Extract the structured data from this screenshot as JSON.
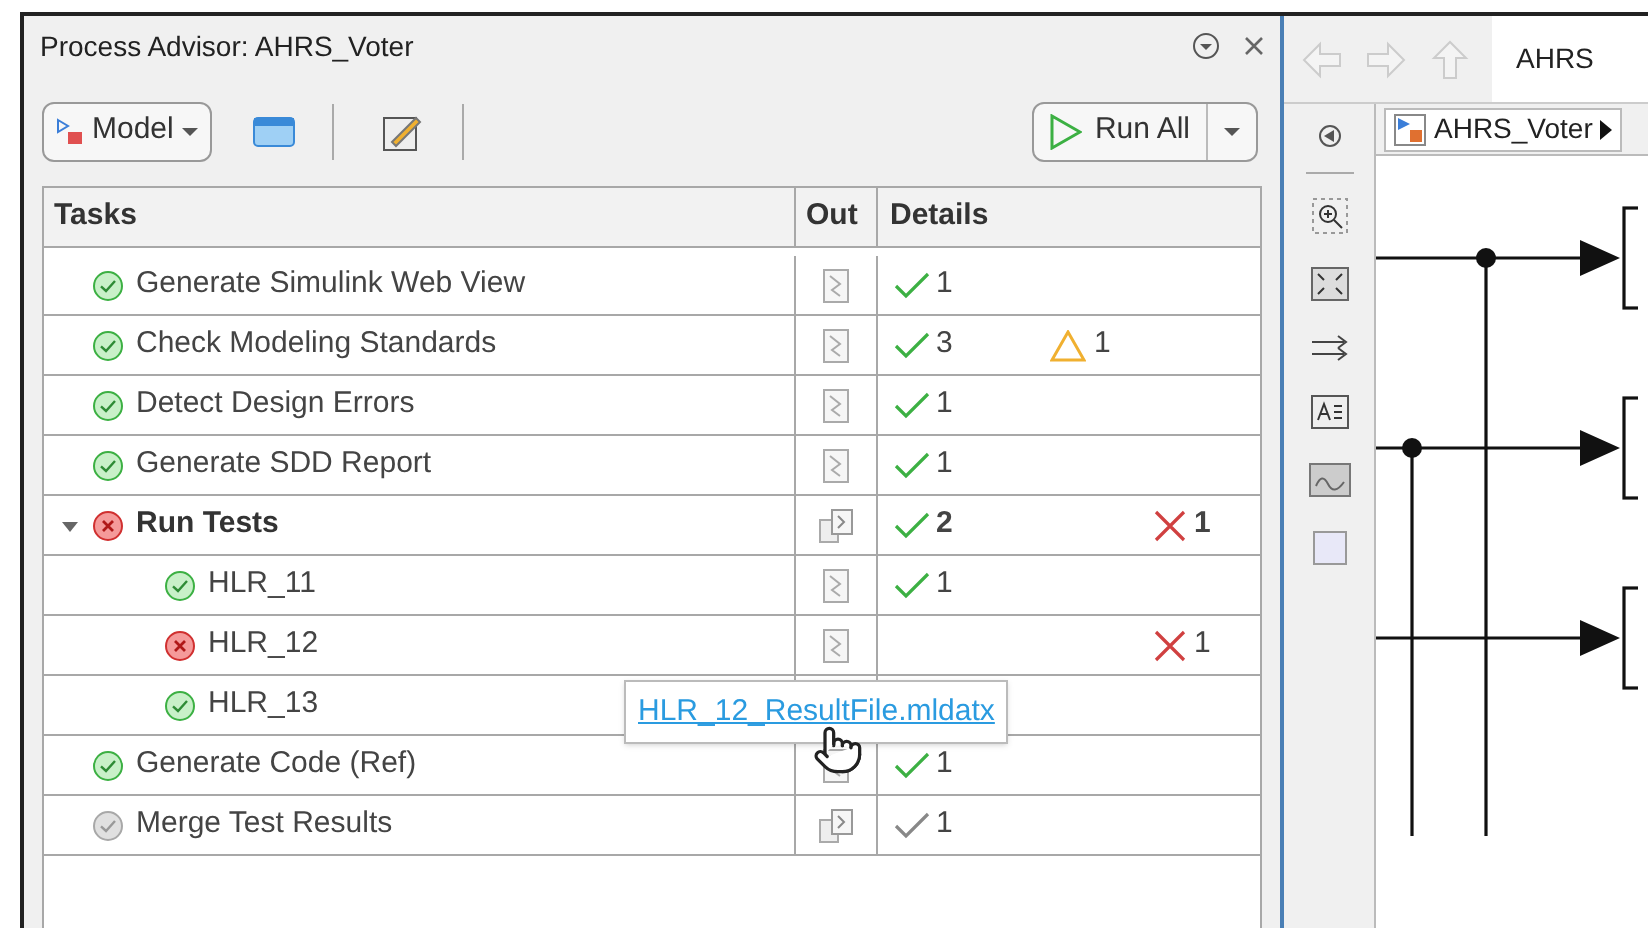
{
  "panel": {
    "title": "Process Advisor: AHRS_Voter",
    "model_button": "Model",
    "run_button": "Run All"
  },
  "table": {
    "columns": [
      "Tasks",
      "Out",
      "Details"
    ],
    "rows": [
      {
        "name": "Generate Simulink Web View",
        "failed": false,
        "stale": false,
        "multiple_outputs": false,
        "details": {
          "pass": "1"
        }
      },
      {
        "name": "Check Modeling Standards",
        "failed": false,
        "stale": false,
        "multiple_outputs": false,
        "details": {
          "pass": "3",
          "warn": "1"
        }
      },
      {
        "name": "Detect Design Errors",
        "failed": false,
        "stale": false,
        "multiple_outputs": false,
        "details": {
          "pass": "1"
        }
      },
      {
        "name": "Generate SDD Report",
        "failed": false,
        "stale": false,
        "multiple_outputs": false,
        "details": {
          "pass": "1"
        }
      },
      {
        "name": "Run Tests",
        "failed": true,
        "stale": false,
        "multiple_outputs": true,
        "expanded": true,
        "details": {
          "pass": "2",
          "fail": "1"
        },
        "children": [
          {
            "name": "HLR_11",
            "failed": false,
            "stale": false,
            "multiple_outputs": false,
            "details": {
              "pass": "1"
            }
          },
          {
            "name": "HLR_12",
            "failed": true,
            "stale": false,
            "multiple_outputs": false,
            "details": {
              "fail": "1"
            }
          },
          {
            "name": "HLR_13",
            "failed": false,
            "stale": false
          }
        ]
      },
      {
        "name": "Generate Code (Ref)",
        "failed": false,
        "stale": false,
        "multiple_outputs": false,
        "details": {
          "pass": "1"
        }
      },
      {
        "name": "Merge Test Results",
        "failed": false,
        "stale": true,
        "multiple_outputs": true,
        "details": {
          "pass": "1"
        }
      }
    ]
  },
  "tooltip": {
    "link": "HLR_12_ResultFile.mldatx"
  },
  "editor": {
    "tab": "AHRS",
    "breadcrumb": "AHRS_Voter"
  }
}
